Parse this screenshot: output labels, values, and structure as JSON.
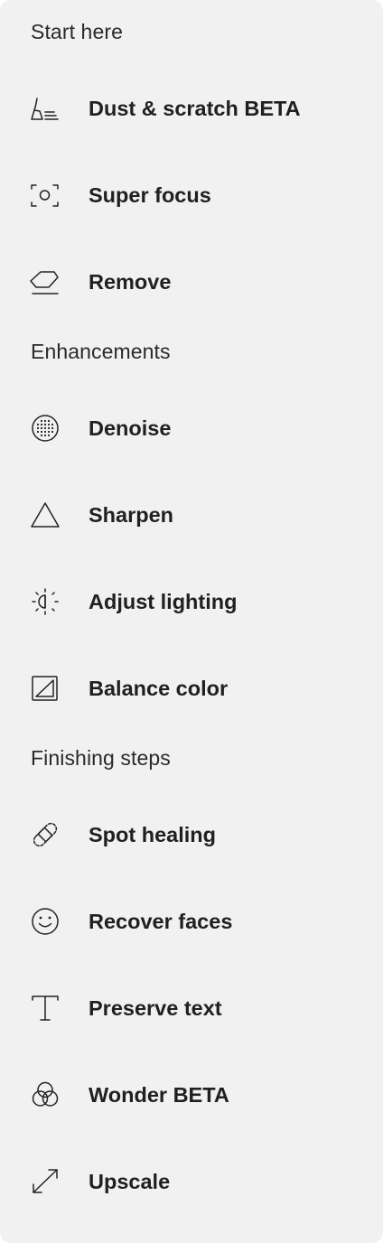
{
  "sections": [
    {
      "title": "Start here",
      "items": [
        {
          "label": "Dust & scratch BETA",
          "icon": "broom-icon"
        },
        {
          "label": "Super focus",
          "icon": "focus-frame-icon"
        },
        {
          "label": "Remove",
          "icon": "eraser-icon"
        }
      ]
    },
    {
      "title": "Enhancements",
      "items": [
        {
          "label": "Denoise",
          "icon": "dotted-circle-icon"
        },
        {
          "label": "Sharpen",
          "icon": "triangle-icon"
        },
        {
          "label": "Adjust lighting",
          "icon": "sun-half-icon"
        },
        {
          "label": "Balance color",
          "icon": "color-balance-icon"
        }
      ]
    },
    {
      "title": "Finishing steps",
      "items": [
        {
          "label": "Spot healing",
          "icon": "bandage-icon"
        },
        {
          "label": "Recover faces",
          "icon": "smiley-face-icon"
        },
        {
          "label": "Preserve text",
          "icon": "text-t-icon"
        },
        {
          "label": "Wonder BETA",
          "icon": "overlapping-circles-icon"
        },
        {
          "label": "Upscale",
          "icon": "diagonal-arrows-icon"
        }
      ]
    }
  ]
}
